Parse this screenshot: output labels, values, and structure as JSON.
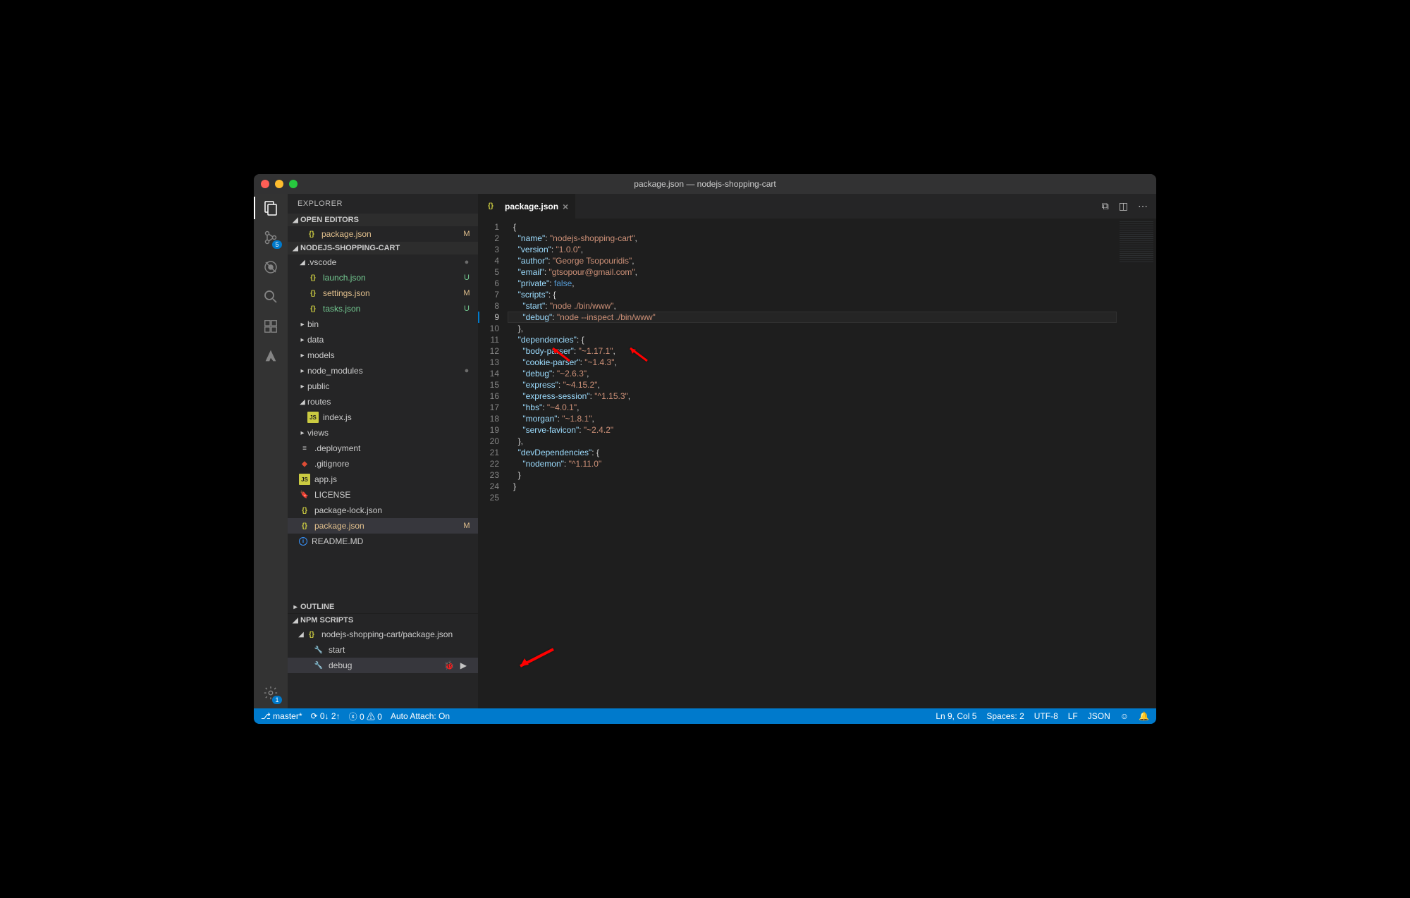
{
  "window": {
    "title": "package.json — nodejs-shopping-cart"
  },
  "sidebar": {
    "title": "EXPLORER",
    "openEditors": {
      "title": "OPEN EDITORS",
      "items": [
        {
          "icon": "{}",
          "label": "package.json",
          "status": "M"
        }
      ]
    },
    "project": {
      "title": "NODEJS-SHOPPING-CART",
      "tree": [
        {
          "depth": 1,
          "type": "folder-open",
          "label": ".vscode",
          "status": "●"
        },
        {
          "depth": 2,
          "type": "json",
          "label": "launch.json",
          "status": "U",
          "gitClass": "git-u"
        },
        {
          "depth": 2,
          "type": "json",
          "label": "settings.json",
          "status": "M",
          "gitClass": "git-m"
        },
        {
          "depth": 2,
          "type": "json",
          "label": "tasks.json",
          "status": "U",
          "gitClass": "git-u"
        },
        {
          "depth": 1,
          "type": "folder",
          "label": "bin"
        },
        {
          "depth": 1,
          "type": "folder",
          "label": "data"
        },
        {
          "depth": 1,
          "type": "folder",
          "label": "models"
        },
        {
          "depth": 1,
          "type": "folder",
          "label": "node_modules",
          "status": "●"
        },
        {
          "depth": 1,
          "type": "folder",
          "label": "public"
        },
        {
          "depth": 1,
          "type": "folder-open",
          "label": "routes"
        },
        {
          "depth": 2,
          "type": "js",
          "label": "index.js"
        },
        {
          "depth": 1,
          "type": "folder",
          "label": "views"
        },
        {
          "depth": 1,
          "type": "lines",
          "label": ".deployment"
        },
        {
          "depth": 1,
          "type": "git",
          "label": ".gitignore"
        },
        {
          "depth": 1,
          "type": "js",
          "label": "app.js"
        },
        {
          "depth": 1,
          "type": "cert",
          "label": "LICENSE"
        },
        {
          "depth": 1,
          "type": "json",
          "label": "package-lock.json"
        },
        {
          "depth": 1,
          "type": "json",
          "label": "package.json",
          "status": "M",
          "gitClass": "git-m",
          "selected": true
        },
        {
          "depth": 1,
          "type": "info",
          "label": "README.MD"
        }
      ]
    },
    "outline": {
      "title": "OUTLINE"
    },
    "npmScripts": {
      "title": "NPM SCRIPTS",
      "package": "nodejs-shopping-cart/package.json",
      "scripts": [
        {
          "name": "start"
        },
        {
          "name": "debug",
          "selected": true
        }
      ]
    }
  },
  "tabs": {
    "active": {
      "icon": "{}",
      "label": "package.json"
    }
  },
  "code": {
    "currentLine": 9,
    "lines": [
      [
        [
          "p",
          "{"
        ]
      ],
      [
        [
          "p",
          "  "
        ],
        [
          "k",
          "\"name\""
        ],
        [
          "p",
          ": "
        ],
        [
          "s",
          "\"nodejs-shopping-cart\""
        ],
        [
          "p",
          ","
        ]
      ],
      [
        [
          "p",
          "  "
        ],
        [
          "k",
          "\"version\""
        ],
        [
          "p",
          ": "
        ],
        [
          "s",
          "\"1.0.0\""
        ],
        [
          "p",
          ","
        ]
      ],
      [
        [
          "p",
          "  "
        ],
        [
          "k",
          "\"author\""
        ],
        [
          "p",
          ": "
        ],
        [
          "s",
          "\"George Tsopouridis\""
        ],
        [
          "p",
          ","
        ]
      ],
      [
        [
          "p",
          "  "
        ],
        [
          "k",
          "\"email\""
        ],
        [
          "p",
          ": "
        ],
        [
          "s",
          "\"gtsopour@gmail.com\""
        ],
        [
          "p",
          ","
        ]
      ],
      [
        [
          "p",
          "  "
        ],
        [
          "k",
          "\"private\""
        ],
        [
          "p",
          ": "
        ],
        [
          "b",
          "false"
        ],
        [
          "p",
          ","
        ]
      ],
      [
        [
          "p",
          "  "
        ],
        [
          "k",
          "\"scripts\""
        ],
        [
          "p",
          ": {"
        ]
      ],
      [
        [
          "p",
          "    "
        ],
        [
          "k",
          "\"start\""
        ],
        [
          "p",
          ": "
        ],
        [
          "s",
          "\"node ./bin/www\""
        ],
        [
          "p",
          ","
        ]
      ],
      [
        [
          "p",
          "    "
        ],
        [
          "k",
          "\"debug\""
        ],
        [
          "p",
          ": "
        ],
        [
          "s",
          "\"node --inspect ./bin/www\""
        ]
      ],
      [
        [
          "p",
          "  },"
        ]
      ],
      [
        [
          "p",
          "  "
        ],
        [
          "k",
          "\"dependencies\""
        ],
        [
          "p",
          ": {"
        ]
      ],
      [
        [
          "p",
          "    "
        ],
        [
          "k",
          "\"body-parser\""
        ],
        [
          "p",
          ": "
        ],
        [
          "s",
          "\"~1.17.1\""
        ],
        [
          "p",
          ","
        ]
      ],
      [
        [
          "p",
          "    "
        ],
        [
          "k",
          "\"cookie-parser\""
        ],
        [
          "p",
          ": "
        ],
        [
          "s",
          "\"~1.4.3\""
        ],
        [
          "p",
          ","
        ]
      ],
      [
        [
          "p",
          "    "
        ],
        [
          "k",
          "\"debug\""
        ],
        [
          "p",
          ": "
        ],
        [
          "s",
          "\"~2.6.3\""
        ],
        [
          "p",
          ","
        ]
      ],
      [
        [
          "p",
          "    "
        ],
        [
          "k",
          "\"express\""
        ],
        [
          "p",
          ": "
        ],
        [
          "s",
          "\"~4.15.2\""
        ],
        [
          "p",
          ","
        ]
      ],
      [
        [
          "p",
          "    "
        ],
        [
          "k",
          "\"express-session\""
        ],
        [
          "p",
          ": "
        ],
        [
          "s",
          "\"^1.15.3\""
        ],
        [
          "p",
          ","
        ]
      ],
      [
        [
          "p",
          "    "
        ],
        [
          "k",
          "\"hbs\""
        ],
        [
          "p",
          ": "
        ],
        [
          "s",
          "\"~4.0.1\""
        ],
        [
          "p",
          ","
        ]
      ],
      [
        [
          "p",
          "    "
        ],
        [
          "k",
          "\"morgan\""
        ],
        [
          "p",
          ": "
        ],
        [
          "s",
          "\"~1.8.1\""
        ],
        [
          "p",
          ","
        ]
      ],
      [
        [
          "p",
          "    "
        ],
        [
          "k",
          "\"serve-favicon\""
        ],
        [
          "p",
          ": "
        ],
        [
          "s",
          "\"~2.4.2\""
        ]
      ],
      [
        [
          "p",
          "  },"
        ]
      ],
      [
        [
          "p",
          "  "
        ],
        [
          "k",
          "\"devDependencies\""
        ],
        [
          "p",
          ": {"
        ]
      ],
      [
        [
          "p",
          "    "
        ],
        [
          "k",
          "\"nodemon\""
        ],
        [
          "p",
          ": "
        ],
        [
          "s",
          "\"^1.11.0\""
        ]
      ],
      [
        [
          "p",
          "  }"
        ]
      ],
      [
        [
          "p",
          "}"
        ]
      ],
      [
        [
          "p",
          ""
        ]
      ]
    ]
  },
  "statusbar": {
    "branch": "master*",
    "sync": "0↓ 2↑",
    "errors": "0",
    "warnings": "0",
    "autoAttach": "Auto Attach: On",
    "lineCol": "Ln 9, Col 5",
    "spaces": "Spaces: 2",
    "encoding": "UTF-8",
    "eol": "LF",
    "language": "JSON"
  },
  "badges": {
    "scm": "5",
    "settings": "1"
  }
}
